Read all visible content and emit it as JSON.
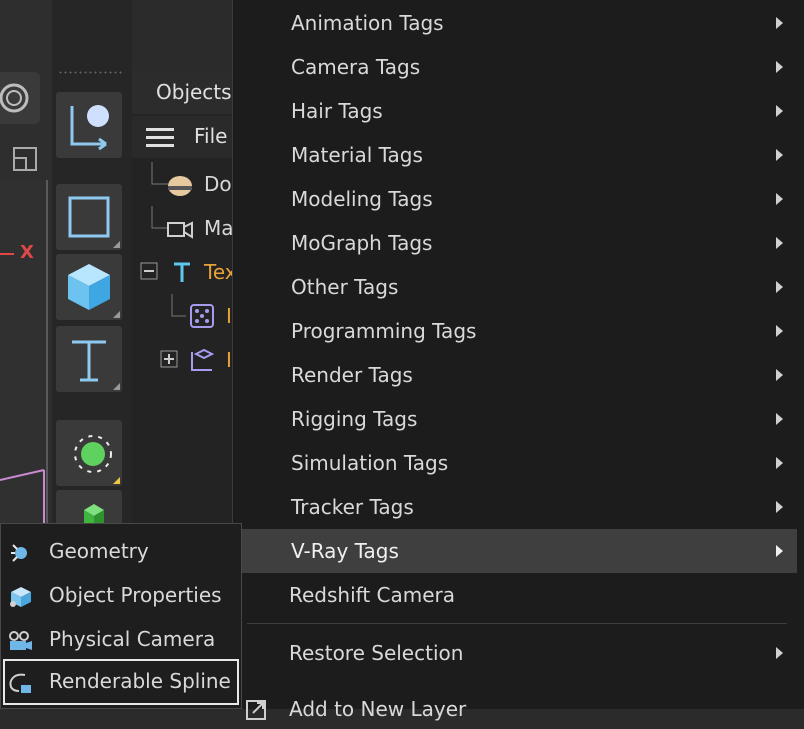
{
  "object_manager": {
    "tab_label": "Objects",
    "menu_label": "File",
    "rows": [
      {
        "label": "Do"
      },
      {
        "label": "Ma"
      },
      {
        "label": "Tex"
      },
      {
        "label": "I"
      },
      {
        "label": "I"
      }
    ]
  },
  "viewport": {
    "axis_label": "X"
  },
  "menu": {
    "items": [
      {
        "label": "Animation Tags",
        "has_submenu": true
      },
      {
        "label": "Camera Tags",
        "has_submenu": true
      },
      {
        "label": "Hair Tags",
        "has_submenu": true
      },
      {
        "label": "Material Tags",
        "has_submenu": true
      },
      {
        "label": "Modeling Tags",
        "has_submenu": true
      },
      {
        "label": "MoGraph Tags",
        "has_submenu": true
      },
      {
        "label": "Other Tags",
        "has_submenu": true
      },
      {
        "label": "Programming Tags",
        "has_submenu": true
      },
      {
        "label": "Render Tags",
        "has_submenu": true
      },
      {
        "label": "Rigging Tags",
        "has_submenu": true
      },
      {
        "label": "Simulation Tags",
        "has_submenu": true
      },
      {
        "label": "Tracker Tags",
        "has_submenu": true
      },
      {
        "label": "V-Ray Tags",
        "has_submenu": true,
        "active": true
      },
      {
        "label": "Redshift Camera",
        "has_submenu": false
      },
      {
        "label": "Restore Selection",
        "has_submenu": true
      },
      {
        "label": "Add to New Layer",
        "has_submenu": false
      }
    ]
  },
  "submenu": {
    "items": [
      {
        "label": "Geometry",
        "icon": "vray-geometry-icon"
      },
      {
        "label": "Object Properties",
        "icon": "object-properties-icon"
      },
      {
        "label": "Physical Camera",
        "icon": "physical-camera-icon"
      },
      {
        "label": "Renderable Spline",
        "icon": "renderable-spline-icon",
        "highlighted": true
      }
    ]
  },
  "colors": {
    "menu_bg": "#1c1c1c",
    "active_bg": "#3f3f3f",
    "text": "#d9d9d9",
    "accent_orange": "#e8a23a",
    "icon_blue": "#8fc9f0"
  }
}
